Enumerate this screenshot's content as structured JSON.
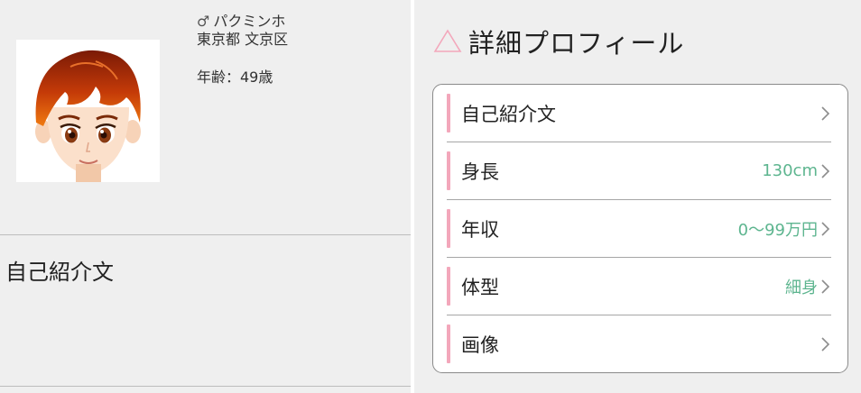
{
  "profile": {
    "gender_symbol": "♂",
    "name": "パクミンホ",
    "location": "東京都 文京区",
    "age_label": "年齢：49歳"
  },
  "self_intro": {
    "title": "自己紹介文"
  },
  "detail": {
    "title": "詳細プロフィール",
    "rows": [
      {
        "label": "自己紹介文",
        "value": ""
      },
      {
        "label": "身長",
        "value": "130cm"
      },
      {
        "label": "年収",
        "value": "0〜99万円"
      },
      {
        "label": "体型",
        "value": "細身"
      },
      {
        "label": "画像",
        "value": ""
      }
    ]
  },
  "colors": {
    "accent_pink": "#f3a7bb",
    "value_green": "#5db58f",
    "panel_bg": "#efefef"
  },
  "icons": {
    "avatar": "cartoon-avatar",
    "section": "triangle-outline-icon",
    "row_arrow": "chevron-right-icon"
  }
}
